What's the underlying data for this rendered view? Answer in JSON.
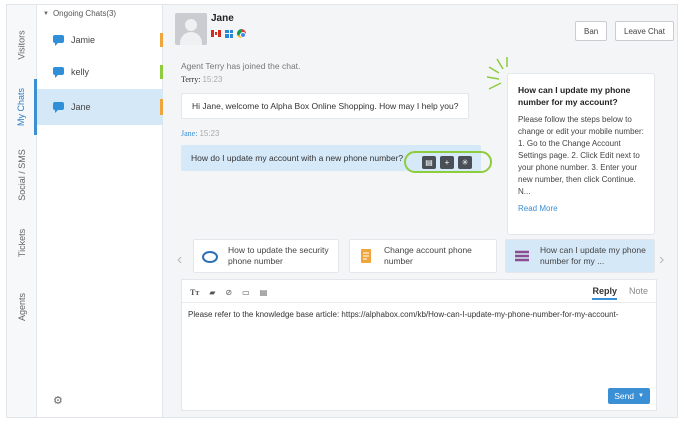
{
  "rail": {
    "tabs": [
      "Visitors",
      "My Chats",
      "Social / SMS",
      "Tickets",
      "Agents"
    ]
  },
  "chat_list": {
    "group_label": "Ongoing Chats(3)",
    "chats": [
      {
        "name": "Jamie",
        "status_color": "#f0a53c"
      },
      {
        "name": "kelly",
        "status_color": "#8dcc3c"
      },
      {
        "name": "Jane",
        "status_color": "#f0a53c"
      }
    ]
  },
  "header": {
    "name": "Jane",
    "ban_label": "Ban",
    "leave_label": "Leave Chat"
  },
  "conversation": {
    "system_msg": "Agent Terry has joined the chat.",
    "agent_name": "Terry:",
    "agent_time": "15:23",
    "agent_msg": "Hi Jane, welcome to Alpha Box Online Shopping. How may I help you?",
    "visitor_name": "Jane:",
    "visitor_time": "15:23",
    "visitor_msg": "How do I update my account with a new phone number?"
  },
  "kb_card": {
    "title": "How can I update my phone number for my account?",
    "body": "Please follow the steps below to change or edit your mobile number: 1. Go to the Change Account Settings page. 2. Click Edit next to your phone number. 3. Enter your new number, then click Continue. N...",
    "more": "Read More"
  },
  "suggestions": [
    {
      "text": "How to update the security phone number",
      "icon": "cloud-icon"
    },
    {
      "text": "Change account phone number",
      "icon": "document-icon"
    },
    {
      "text": "How can I update my phone number for my ...",
      "icon": "stack-icon"
    }
  ],
  "composer": {
    "reply_tab": "Reply",
    "note_tab": "Note",
    "text": "Please refer to the knowledge base article: https://alphabox.com/kb/How-can-I-update-my-phone-number-for-my-account-",
    "send_label": "Send"
  },
  "colors": {
    "accent": "#3b8fd4",
    "highlight": "#8dcc3c",
    "active_bg": "#d4e8f8"
  }
}
